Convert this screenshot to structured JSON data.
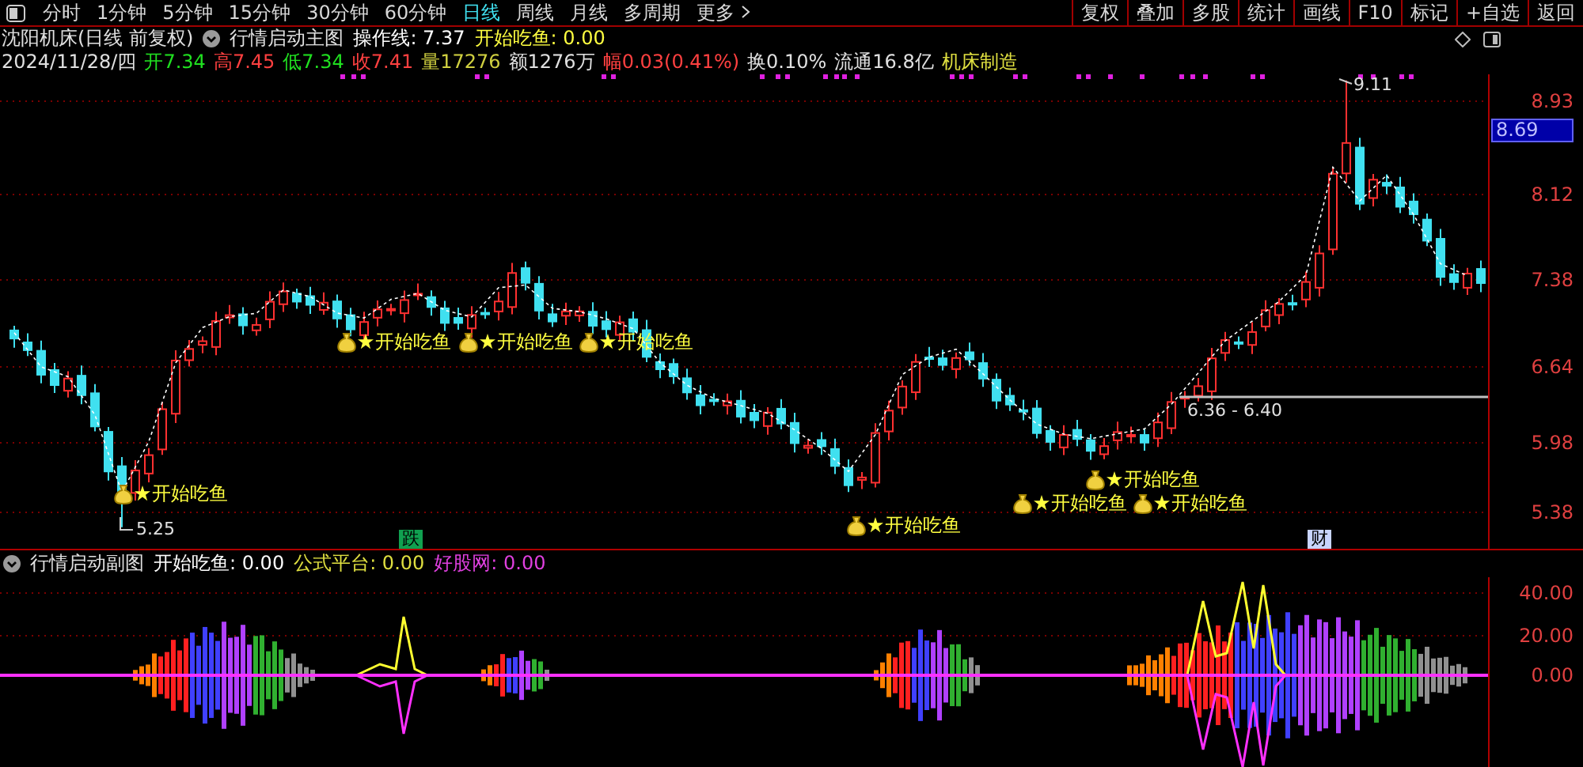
{
  "toolbar": {
    "periods": [
      {
        "label": "分时",
        "selected": false
      },
      {
        "label": "1分钟",
        "selected": false
      },
      {
        "label": "5分钟",
        "selected": false
      },
      {
        "label": "15分钟",
        "selected": false
      },
      {
        "label": "30分钟",
        "selected": false
      },
      {
        "label": "60分钟",
        "selected": false
      },
      {
        "label": "日线",
        "selected": true
      },
      {
        "label": "周线",
        "selected": false
      },
      {
        "label": "月线",
        "selected": false
      },
      {
        "label": "多周期",
        "selected": false
      },
      {
        "label": "更多",
        "selected": false
      }
    ],
    "actions": [
      "复权",
      "叠加",
      "多股",
      "统计",
      "画线",
      "F10",
      "标记",
      "+自选",
      "返回"
    ]
  },
  "main_header": {
    "title": "沈阳机床(日线 前复权)",
    "indicator": "行情启动主图",
    "readouts": [
      {
        "text": "操作线: 7.37",
        "color": "#ffffff"
      },
      {
        "text": "开始吃鱼: 0.00",
        "color": "#ffff40"
      }
    ]
  },
  "quote": {
    "date": "2024/11/28/四",
    "fields": [
      {
        "text": "开7.34",
        "color": "#20e020"
      },
      {
        "text": "高7.45",
        "color": "#ff4040"
      },
      {
        "text": "低7.34",
        "color": "#20e020"
      },
      {
        "text": "收7.41",
        "color": "#ff4040"
      },
      {
        "text": "量17276",
        "color": "#d0d040"
      },
      {
        "text": "额1276万",
        "color": "#e0e0e0"
      },
      {
        "text": "幅0.03(0.41%)",
        "color": "#ff4040"
      },
      {
        "text": "换0.10%",
        "color": "#e0e0e0"
      },
      {
        "text": "流通16.8亿",
        "color": "#e0e0e0"
      },
      {
        "text": "机床制造",
        "color": "#e0e040"
      }
    ]
  },
  "main_chart": {
    "price_ticks": [
      "8.93",
      "8.12",
      "7.38",
      "6.64",
      "5.98",
      "5.38"
    ],
    "current_price": "8.69",
    "signals": [
      "开始吃鱼",
      "开始吃鱼",
      "开始吃鱼",
      "开始吃鱼",
      "开始吃鱼",
      "开始吃鱼",
      "开始吃鱼",
      "开始吃鱼"
    ],
    "price_labels": [
      "5.25",
      "9.11",
      "6.36 - 6.40"
    ],
    "event_markers": [
      {
        "text": "跌",
        "color": "#10a050"
      },
      {
        "text": "财",
        "color": "#c8d4ff"
      }
    ]
  },
  "sub_header": {
    "indicator": "行情启动副图",
    "readouts": [
      {
        "text": "开始吃鱼: 0.00",
        "color": "#ffffff"
      },
      {
        "text": "公式平台: 0.00",
        "color": "#e0e040"
      },
      {
        "text": "好股网: 0.00",
        "color": "#e040e0"
      }
    ]
  },
  "sub_chart": {
    "ticks": [
      "40.00",
      "20.00",
      "0.00"
    ]
  }
}
